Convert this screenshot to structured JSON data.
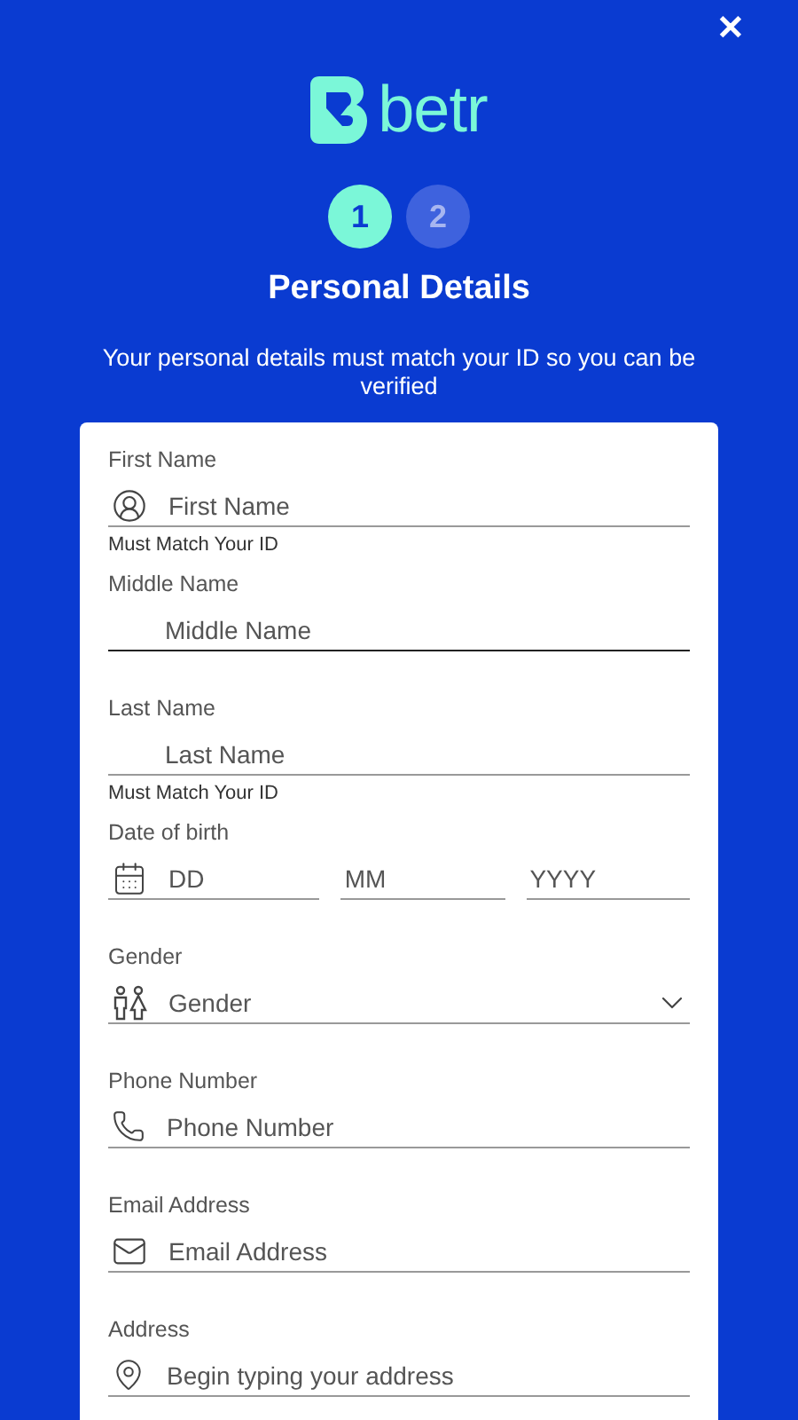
{
  "close": "✕",
  "brand": "betr",
  "steps": [
    {
      "label": "1",
      "selected": true
    },
    {
      "label": "2",
      "selected": false
    }
  ],
  "title": "Personal Details",
  "subtitle": "Your personal details must match your ID so you can be verified",
  "fields": [
    {
      "kind": "person",
      "label": "First Name",
      "placeholder": "First Name",
      "hint": "Must Match Your ID",
      "focused": false
    },
    {
      "kind": "plain",
      "label": "Middle Name",
      "placeholder": "Middle Name",
      "focused": true
    },
    {
      "kind": "plain",
      "label": "Last Name",
      "placeholder": "Last Name",
      "hint": "Must Match Your ID",
      "focused": false
    },
    {
      "kind": "date",
      "label": "Date of birth",
      "parts": [
        "DD",
        "MM",
        "YYYY"
      ],
      "focused": false
    },
    {
      "kind": "gender",
      "label": "Gender",
      "placeholder": "Gender",
      "focused": false
    },
    {
      "kind": "phone",
      "label": "Phone Number",
      "placeholder": "Phone Number",
      "focused": false
    },
    {
      "kind": "email",
      "label": "Email Address",
      "placeholder": "Email Address",
      "focused": false
    },
    {
      "kind": "address",
      "label": "Address",
      "placeholder": "Begin typing your address",
      "focused": false
    }
  ]
}
